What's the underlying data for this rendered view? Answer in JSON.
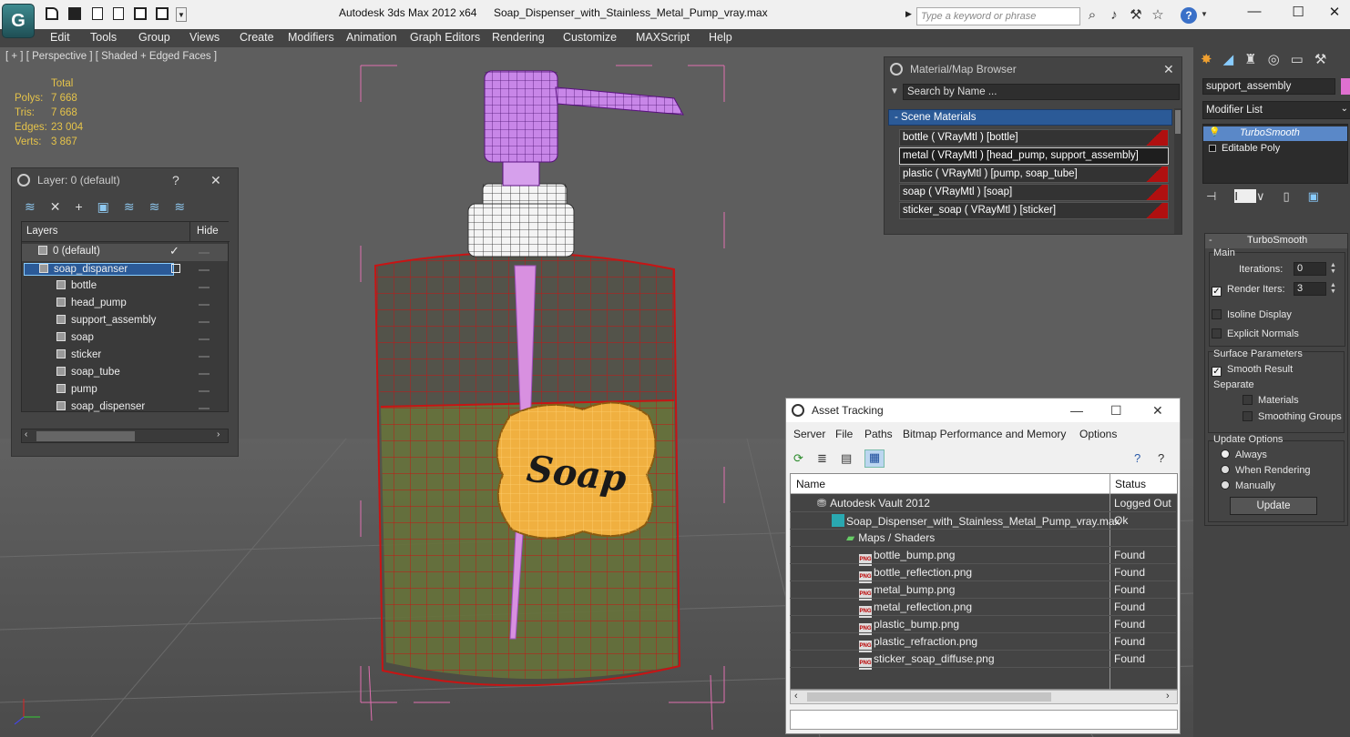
{
  "titlebar": {
    "app_title": "Autodesk 3ds Max  2012 x64",
    "file_title": "Soap_Dispenser_with_Stainless_Metal_Pump_vray.max",
    "search_placeholder": "Type a keyword or phrase",
    "logo_glyph": "G"
  },
  "menus": [
    "Edit",
    "Tools",
    "Group",
    "Views",
    "Create",
    "Modifiers",
    "Animation",
    "Graph Editors",
    "Rendering",
    "Customize",
    "MAXScript",
    "Help"
  ],
  "viewport": {
    "label": "[ + ] [ Perspective ] [ Shaded + Edged Faces ]",
    "stats_header": "Total",
    "stats": [
      {
        "label": "Polys:",
        "value": "7 668"
      },
      {
        "label": "Tris:",
        "value": "7 668"
      },
      {
        "label": "Edges:",
        "value": "23 004"
      },
      {
        "label": "Verts:",
        "value": "3 867"
      }
    ],
    "sticker_text": "Soap"
  },
  "layer_panel": {
    "title": "Layer: 0 (default)",
    "help": "?",
    "col_layers": "Layers",
    "col_hide": "Hide",
    "rows": [
      {
        "label": "0 (default)",
        "indent": 0
      },
      {
        "label": "soap_dispanser",
        "indent": 0
      },
      {
        "label": "bottle",
        "indent": 1
      },
      {
        "label": "head_pump",
        "indent": 1
      },
      {
        "label": "support_assembly",
        "indent": 1
      },
      {
        "label": "soap",
        "indent": 1
      },
      {
        "label": "sticker",
        "indent": 1
      },
      {
        "label": "soap_tube",
        "indent": 1
      },
      {
        "label": "pump",
        "indent": 1
      },
      {
        "label": "soap_dispenser",
        "indent": 1
      }
    ]
  },
  "material_browser": {
    "title": "Material/Map Browser",
    "search_placeholder": "Search by Name ...",
    "group": "- Scene Materials",
    "materials": [
      "bottle  ( VRayMtl ) [bottle]",
      "metal  ( VRayMtl ) [head_pump, support_assembly]",
      "plastic  ( VRayMtl ) [pump, soap_tube]",
      "soap  ( VRayMtl ) [soap]",
      "sticker_soap  ( VRayMtl ) [sticker]"
    ]
  },
  "asset_tracking": {
    "title": "Asset Tracking",
    "menus": [
      "Server",
      "File",
      "Paths",
      "Bitmap Performance and Memory",
      "Options"
    ],
    "col_name": "Name",
    "col_status": "Status",
    "rows": [
      {
        "name": "Autodesk Vault 2012",
        "status": "Logged Out",
        "level": 0
      },
      {
        "name": "Soap_Dispenser_with_Stainless_Metal_Pump_vray.max",
        "status": "Ok",
        "level": 1
      },
      {
        "name": "Maps / Shaders",
        "status": "",
        "level": 2
      },
      {
        "name": "bottle_bump.png",
        "status": "Found",
        "level": 3
      },
      {
        "name": "bottle_reflection.png",
        "status": "Found",
        "level": 3
      },
      {
        "name": "metal_bump.png",
        "status": "Found",
        "level": 3
      },
      {
        "name": "metal_reflection.png",
        "status": "Found",
        "level": 3
      },
      {
        "name": "plastic_bump.png",
        "status": "Found",
        "level": 3
      },
      {
        "name": "plastic_refraction.png",
        "status": "Found",
        "level": 3
      },
      {
        "name": "sticker_soap_diffuse.png",
        "status": "Found",
        "level": 3
      }
    ],
    "png_tag": "PNG"
  },
  "command_panel": {
    "object_name": "support_assembly",
    "modifier_list": "Modifier List",
    "stack": [
      "TurboSmooth",
      "Editable Poly"
    ],
    "rollout_title": "TurboSmooth",
    "main_label": "Main",
    "iterations_label": "Iterations:",
    "iterations_value": "0",
    "render_iters_label": "Render Iters:",
    "render_iters_value": "3",
    "isoline": "Isoline Display",
    "explicit": "Explicit Normals",
    "surface_params": "Surface Parameters",
    "smooth_result": "Smooth Result",
    "separate": "Separate",
    "materials": "Materials",
    "smoothing_groups": "Smoothing Groups",
    "update_options": "Update Options",
    "always": "Always",
    "when_rendering": "When Rendering",
    "manually": "Manually",
    "update_button": "Update"
  },
  "colors": {
    "wire_red": "#c81414",
    "wire_pink": "#e070b0",
    "wire_violet": "#c060e0",
    "sticker_orange": "#f0b040",
    "stat_yellow": "#e5c34a"
  }
}
